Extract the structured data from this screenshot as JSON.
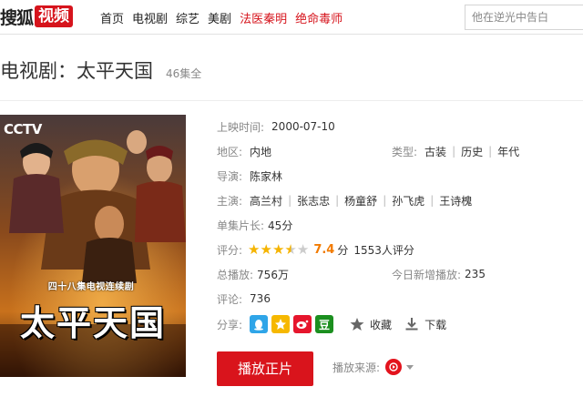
{
  "header": {
    "logo_text": "搜狐",
    "logo_badge": "视频",
    "nav": [
      "首页",
      "电视剧",
      "综艺",
      "美剧",
      "法医秦明",
      "绝命毒师"
    ],
    "search_placeholder": "他在逆光中告白"
  },
  "title": {
    "text": "电视剧：太平天国",
    "episodes": "46集全"
  },
  "poster": {
    "channel_logo": "CCTV",
    "subtitle": "四十八集电视连续剧",
    "name": "太平天国"
  },
  "info": {
    "release_label": "上映时间:",
    "release_value": "2000-07-10",
    "region_label": "地区:",
    "region_value": "内地",
    "genre_label": "类型:",
    "genres": [
      "古装",
      "历史",
      "年代"
    ],
    "director_label": "导演:",
    "director_value": "陈家林",
    "cast_label": "主演:",
    "cast": [
      "高兰村",
      "张志忠",
      "杨童舒",
      "孙飞虎",
      "王诗槐"
    ],
    "duration_label": "单集片长:",
    "duration_value": "45分",
    "rating_label": "评分:",
    "rating_stars": 3.5,
    "rating_score": "7.4",
    "rating_unit": "分",
    "rating_count": "1553人评分",
    "plays_label": "总播放:",
    "plays_value": "756万",
    "daily_label": "今日新增播放:",
    "daily_value": "235",
    "comments_label": "评论:",
    "comments_value": "736",
    "share_label": "分享:",
    "share_douban": "豆",
    "collect_label": "收藏",
    "download_label": "下载"
  },
  "actions": {
    "play_label": "播放正片",
    "source_label": "播放来源:"
  },
  "colors": {
    "brand_red": "#d6141c",
    "star": "#f5b400",
    "score": "#f27b00"
  }
}
